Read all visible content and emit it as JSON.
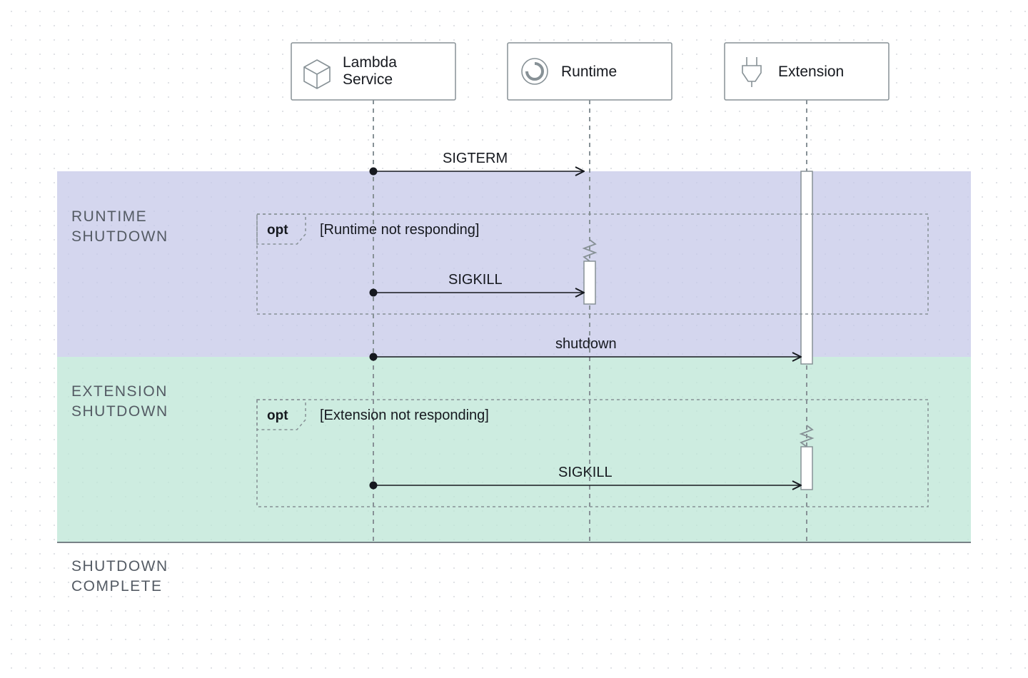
{
  "participants": {
    "lambda": {
      "label": "Lambda\nService",
      "icon": "cube-icon"
    },
    "runtime": {
      "label": "Runtime",
      "icon": "spinner-icon"
    },
    "extension": {
      "label": "Extension",
      "icon": "plug-icon"
    }
  },
  "phases": {
    "runtime_shutdown": {
      "line1": "RUNTIME",
      "line2": "SHUTDOWN"
    },
    "extension_shutdown": {
      "line1": "EXTENSION",
      "line2": "SHUTDOWN"
    },
    "complete": {
      "line1": "SHUTDOWN",
      "line2": "COMPLETE"
    }
  },
  "messages": {
    "sigterm": "SIGTERM",
    "sigkill_runtime": "SIGKILL",
    "shutdown": "shutdown",
    "sigkill_extension": "SIGKILL"
  },
  "opt_frames": {
    "tag": "opt",
    "runtime_guard": "[Runtime not responding]",
    "extension_guard": "[Extension not responding]"
  },
  "colors": {
    "phase_runtime": "#c6c8e8",
    "phase_extension": "#bce6d6",
    "phase_alpha": 0.75
  }
}
